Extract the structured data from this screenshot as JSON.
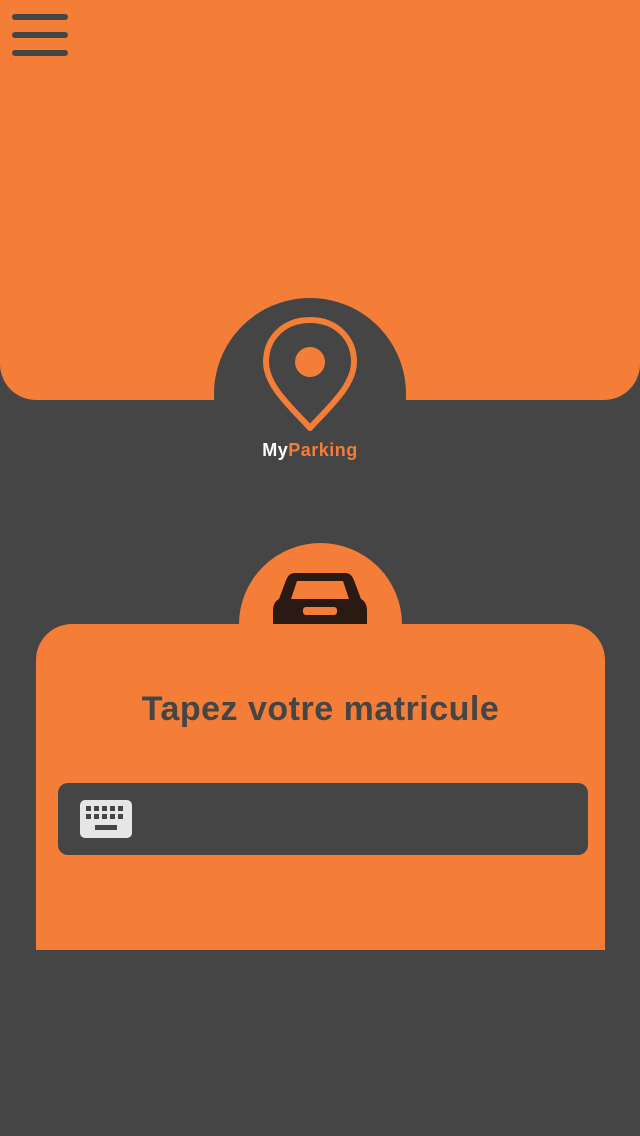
{
  "app": {
    "brand_part1": "My",
    "brand_part2": "Parking"
  },
  "header": {
    "menu_icon": "hamburger-menu-icon",
    "logo_icon": "location-pin-icon"
  },
  "form": {
    "car_icon": "car-icon",
    "title": "Tapez votre matricule",
    "input_icon": "keyboard-icon",
    "input_value": "",
    "input_placeholder": ""
  },
  "colors": {
    "accent": "#f47d38",
    "dark": "#454545",
    "car": "#2b1a14",
    "keyboard": "#e6e6e6"
  }
}
